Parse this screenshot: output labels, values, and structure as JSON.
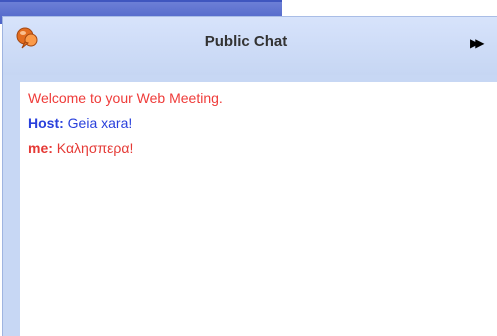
{
  "window": {
    "title": "Public Chat",
    "collapse_glyph": "▶▶",
    "icon": "chat-bubble-icon",
    "accent": "#e36d20",
    "title_bar_color": "#c7d7f4"
  },
  "messages": [
    {
      "text": "Welcome to your Web Meeting.",
      "color": "#ef3b39"
    },
    {
      "sender": "Host:",
      "text": "Geia xara!",
      "color": "#2940dc"
    },
    {
      "sender": "me:",
      "text": "Καλησπερα!",
      "color": "#e53935"
    }
  ]
}
